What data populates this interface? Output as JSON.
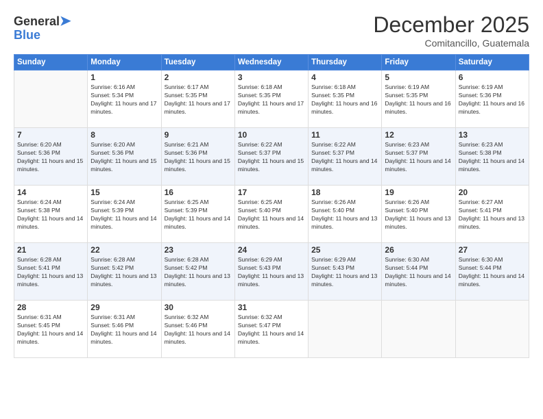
{
  "logo": {
    "general": "General",
    "blue": "Blue"
  },
  "header": {
    "month_year": "December 2025",
    "location": "Comitancillo, Guatemala"
  },
  "days_of_week": [
    "Sunday",
    "Monday",
    "Tuesday",
    "Wednesday",
    "Thursday",
    "Friday",
    "Saturday"
  ],
  "weeks": [
    [
      {
        "day": "",
        "sunrise": "",
        "sunset": "",
        "daylight": ""
      },
      {
        "day": "1",
        "sunrise": "Sunrise: 6:16 AM",
        "sunset": "Sunset: 5:34 PM",
        "daylight": "Daylight: 11 hours and 17 minutes."
      },
      {
        "day": "2",
        "sunrise": "Sunrise: 6:17 AM",
        "sunset": "Sunset: 5:35 PM",
        "daylight": "Daylight: 11 hours and 17 minutes."
      },
      {
        "day": "3",
        "sunrise": "Sunrise: 6:18 AM",
        "sunset": "Sunset: 5:35 PM",
        "daylight": "Daylight: 11 hours and 17 minutes."
      },
      {
        "day": "4",
        "sunrise": "Sunrise: 6:18 AM",
        "sunset": "Sunset: 5:35 PM",
        "daylight": "Daylight: 11 hours and 16 minutes."
      },
      {
        "day": "5",
        "sunrise": "Sunrise: 6:19 AM",
        "sunset": "Sunset: 5:35 PM",
        "daylight": "Daylight: 11 hours and 16 minutes."
      },
      {
        "day": "6",
        "sunrise": "Sunrise: 6:19 AM",
        "sunset": "Sunset: 5:36 PM",
        "daylight": "Daylight: 11 hours and 16 minutes."
      }
    ],
    [
      {
        "day": "7",
        "sunrise": "Sunrise: 6:20 AM",
        "sunset": "Sunset: 5:36 PM",
        "daylight": "Daylight: 11 hours and 15 minutes."
      },
      {
        "day": "8",
        "sunrise": "Sunrise: 6:20 AM",
        "sunset": "Sunset: 5:36 PM",
        "daylight": "Daylight: 11 hours and 15 minutes."
      },
      {
        "day": "9",
        "sunrise": "Sunrise: 6:21 AM",
        "sunset": "Sunset: 5:36 PM",
        "daylight": "Daylight: 11 hours and 15 minutes."
      },
      {
        "day": "10",
        "sunrise": "Sunrise: 6:22 AM",
        "sunset": "Sunset: 5:37 PM",
        "daylight": "Daylight: 11 hours and 15 minutes."
      },
      {
        "day": "11",
        "sunrise": "Sunrise: 6:22 AM",
        "sunset": "Sunset: 5:37 PM",
        "daylight": "Daylight: 11 hours and 14 minutes."
      },
      {
        "day": "12",
        "sunrise": "Sunrise: 6:23 AM",
        "sunset": "Sunset: 5:37 PM",
        "daylight": "Daylight: 11 hours and 14 minutes."
      },
      {
        "day": "13",
        "sunrise": "Sunrise: 6:23 AM",
        "sunset": "Sunset: 5:38 PM",
        "daylight": "Daylight: 11 hours and 14 minutes."
      }
    ],
    [
      {
        "day": "14",
        "sunrise": "Sunrise: 6:24 AM",
        "sunset": "Sunset: 5:38 PM",
        "daylight": "Daylight: 11 hours and 14 minutes."
      },
      {
        "day": "15",
        "sunrise": "Sunrise: 6:24 AM",
        "sunset": "Sunset: 5:39 PM",
        "daylight": "Daylight: 11 hours and 14 minutes."
      },
      {
        "day": "16",
        "sunrise": "Sunrise: 6:25 AM",
        "sunset": "Sunset: 5:39 PM",
        "daylight": "Daylight: 11 hours and 14 minutes."
      },
      {
        "day": "17",
        "sunrise": "Sunrise: 6:25 AM",
        "sunset": "Sunset: 5:40 PM",
        "daylight": "Daylight: 11 hours and 14 minutes."
      },
      {
        "day": "18",
        "sunrise": "Sunrise: 6:26 AM",
        "sunset": "Sunset: 5:40 PM",
        "daylight": "Daylight: 11 hours and 13 minutes."
      },
      {
        "day": "19",
        "sunrise": "Sunrise: 6:26 AM",
        "sunset": "Sunset: 5:40 PM",
        "daylight": "Daylight: 11 hours and 13 minutes."
      },
      {
        "day": "20",
        "sunrise": "Sunrise: 6:27 AM",
        "sunset": "Sunset: 5:41 PM",
        "daylight": "Daylight: 11 hours and 13 minutes."
      }
    ],
    [
      {
        "day": "21",
        "sunrise": "Sunrise: 6:28 AM",
        "sunset": "Sunset: 5:41 PM",
        "daylight": "Daylight: 11 hours and 13 minutes."
      },
      {
        "day": "22",
        "sunrise": "Sunrise: 6:28 AM",
        "sunset": "Sunset: 5:42 PM",
        "daylight": "Daylight: 11 hours and 13 minutes."
      },
      {
        "day": "23",
        "sunrise": "Sunrise: 6:28 AM",
        "sunset": "Sunset: 5:42 PM",
        "daylight": "Daylight: 11 hours and 13 minutes."
      },
      {
        "day": "24",
        "sunrise": "Sunrise: 6:29 AM",
        "sunset": "Sunset: 5:43 PM",
        "daylight": "Daylight: 11 hours and 13 minutes."
      },
      {
        "day": "25",
        "sunrise": "Sunrise: 6:29 AM",
        "sunset": "Sunset: 5:43 PM",
        "daylight": "Daylight: 11 hours and 13 minutes."
      },
      {
        "day": "26",
        "sunrise": "Sunrise: 6:30 AM",
        "sunset": "Sunset: 5:44 PM",
        "daylight": "Daylight: 11 hours and 14 minutes."
      },
      {
        "day": "27",
        "sunrise": "Sunrise: 6:30 AM",
        "sunset": "Sunset: 5:44 PM",
        "daylight": "Daylight: 11 hours and 14 minutes."
      }
    ],
    [
      {
        "day": "28",
        "sunrise": "Sunrise: 6:31 AM",
        "sunset": "Sunset: 5:45 PM",
        "daylight": "Daylight: 11 hours and 14 minutes."
      },
      {
        "day": "29",
        "sunrise": "Sunrise: 6:31 AM",
        "sunset": "Sunset: 5:46 PM",
        "daylight": "Daylight: 11 hours and 14 minutes."
      },
      {
        "day": "30",
        "sunrise": "Sunrise: 6:32 AM",
        "sunset": "Sunset: 5:46 PM",
        "daylight": "Daylight: 11 hours and 14 minutes."
      },
      {
        "day": "31",
        "sunrise": "Sunrise: 6:32 AM",
        "sunset": "Sunset: 5:47 PM",
        "daylight": "Daylight: 11 hours and 14 minutes."
      },
      {
        "day": "",
        "sunrise": "",
        "sunset": "",
        "daylight": ""
      },
      {
        "day": "",
        "sunrise": "",
        "sunset": "",
        "daylight": ""
      },
      {
        "day": "",
        "sunrise": "",
        "sunset": "",
        "daylight": ""
      }
    ]
  ]
}
